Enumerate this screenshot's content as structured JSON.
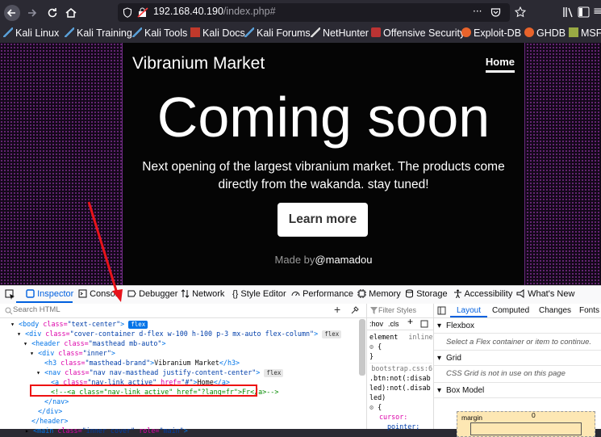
{
  "browser": {
    "url_host": "192.168.40.190",
    "url_path": "/index.php#",
    "bookmarks": [
      "Kali Linux",
      "Kali Training",
      "Kali Tools",
      "Kali Docs",
      "Kali Forums",
      "NetHunter",
      "Offensive Security",
      "Exploit-DB",
      "GHDB",
      "MSFU"
    ]
  },
  "page": {
    "brand": "Vibranium Market",
    "nav_home": "Home",
    "heading": "Coming soon",
    "lead": "Next opening of the largest vibranium market. The products come directly from the wakanda. stay tuned!",
    "button": "Learn more",
    "footer_prefix": "Made by",
    "footer_author": "@mamadou"
  },
  "devtools": {
    "tabs": [
      "Inspector",
      "Console",
      "Debugger",
      "Network",
      "Style Editor",
      "Performance",
      "Memory",
      "Storage",
      "Accessibility",
      "What's New"
    ],
    "search_placeholder": "Search HTML",
    "tree": {
      "body": {
        "tag": "<body",
        "attr": " class=",
        "val": "\"text-center\"",
        "end": ">",
        "badge": "flex"
      },
      "div_cover": {
        "tag": "<div",
        "attr": " class=",
        "val": "\"cover-container d-flex w-100 h-100 p-3 mx-auto flex-column\"",
        "end": ">",
        "badge": "flex"
      },
      "header": {
        "tag": "<header",
        "attr": " class=",
        "val": "\"masthead mb-auto\"",
        "end": ">"
      },
      "div_inner": {
        "tag": "<div",
        "attr": " class=",
        "val": "\"inner\"",
        "end": ">"
      },
      "h3": {
        "tag": "<h3",
        "attr": " class=",
        "val": "\"masthead-brand\"",
        "end": ">",
        "text": "Vibranium Market",
        "close": "</h3>"
      },
      "nav": {
        "tag": "<nav",
        "attr": " class=",
        "val": "\"nav nav-masthead justify-content-center\"",
        "end": ">",
        "badge": "flex"
      },
      "a_home": {
        "tag": "<a",
        "attr": " class=",
        "val": "\"nav-link active\"",
        "attr2": " href=",
        "val2": "\"#\"",
        "end": ">",
        "text": "Home",
        "close": "</a>"
      },
      "comment": "<!--<a class=\"nav-link active\" href=\"?lang=fr\">Fr</a>-->",
      "nav_close": "</nav>",
      "div_close": "</div>",
      "header_close": "</header>",
      "main": {
        "tag": "<main",
        "attr": " class=",
        "val": "\"inner cover\"",
        "attr2": " role=",
        "val2": "\"main\"",
        "end": ">"
      }
    },
    "styles": {
      "filter_placeholder": "Filter Styles",
      "hov": ":hov",
      "cls": ".cls",
      "element_label": "element",
      "element_inline": "inline",
      "brace_open": "{",
      "brace_close": "}",
      "source": "bootstrap.css:6",
      "selector": ".btn:not(:disabled):not(.disabled)",
      "prop": "cursor:",
      "value": "pointer;"
    },
    "layout": {
      "tabs": [
        "Layout",
        "Computed",
        "Changes",
        "Fonts"
      ],
      "flexbox_title": "Flexbox",
      "flexbox_note": "Select a Flex container or item to continue.",
      "grid_title": "Grid",
      "grid_note": "CSS Grid is not in use on this page",
      "boxmodel_title": "Box Model",
      "margin_label": "margin",
      "margin_value": "0"
    }
  }
}
